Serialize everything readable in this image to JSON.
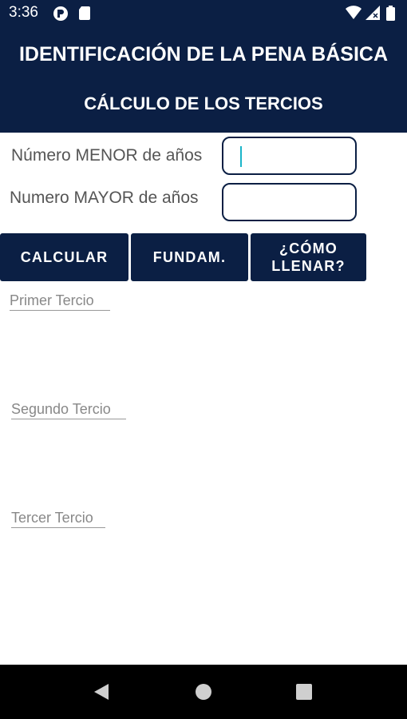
{
  "status_bar": {
    "time": "3:36",
    "left_icons": [
      "app-notification-icon",
      "sd-card-icon"
    ],
    "right_icons": [
      "wifi-icon",
      "signal-icon",
      "battery-icon"
    ]
  },
  "header": {
    "title": "IDENTIFICACIÓN DE LA PENA BÁSICA",
    "subtitle": "CÁLCULO DE LOS TERCIOS"
  },
  "form": {
    "min_label": "Número MENOR de años",
    "min_value": "",
    "max_label": "Numero MAYOR de años",
    "max_value": ""
  },
  "buttons": {
    "calcular": "CALCULAR",
    "fundam": "FUNDAM.",
    "como_llenar": "¿CÓMO LLENAR?"
  },
  "results": {
    "primer": "Primer Tercio",
    "segundo": "Segundo Tercio",
    "tercer": "Tercer Tercio"
  },
  "nav_bar": {
    "icons": [
      "back-icon",
      "home-icon",
      "recents-icon"
    ]
  },
  "colors": {
    "primary": "#0b1f44",
    "cursor": "#1bb5c9",
    "label_text": "#555555",
    "result_text": "#888888"
  }
}
